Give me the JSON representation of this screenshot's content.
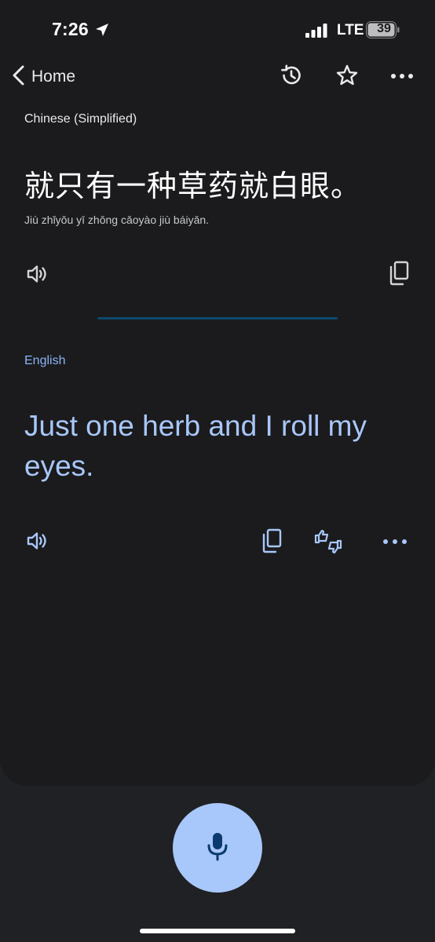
{
  "status_bar": {
    "time": "7:26",
    "network": "LTE",
    "battery": "39"
  },
  "toolbar": {
    "back_label": "Home"
  },
  "source": {
    "language": "Chinese (Simplified)",
    "text": "就只有一种草药就白眼。",
    "romanization": "Jiù zhǐyǒu yī zhǒng cǎoyào jiù báiyǎn."
  },
  "target": {
    "language": "English",
    "text": "Just one herb and I roll my eyes."
  },
  "colors": {
    "accent": "#8ab4f8",
    "translation": "#a8c7fa",
    "mic": "#a8c7fa",
    "card": "#1b1b1d",
    "background": "#202124"
  },
  "icons": [
    "location-arrow",
    "signal",
    "battery",
    "back-chevron",
    "history",
    "star",
    "more",
    "speaker",
    "copy",
    "feedback",
    "microphone"
  ]
}
